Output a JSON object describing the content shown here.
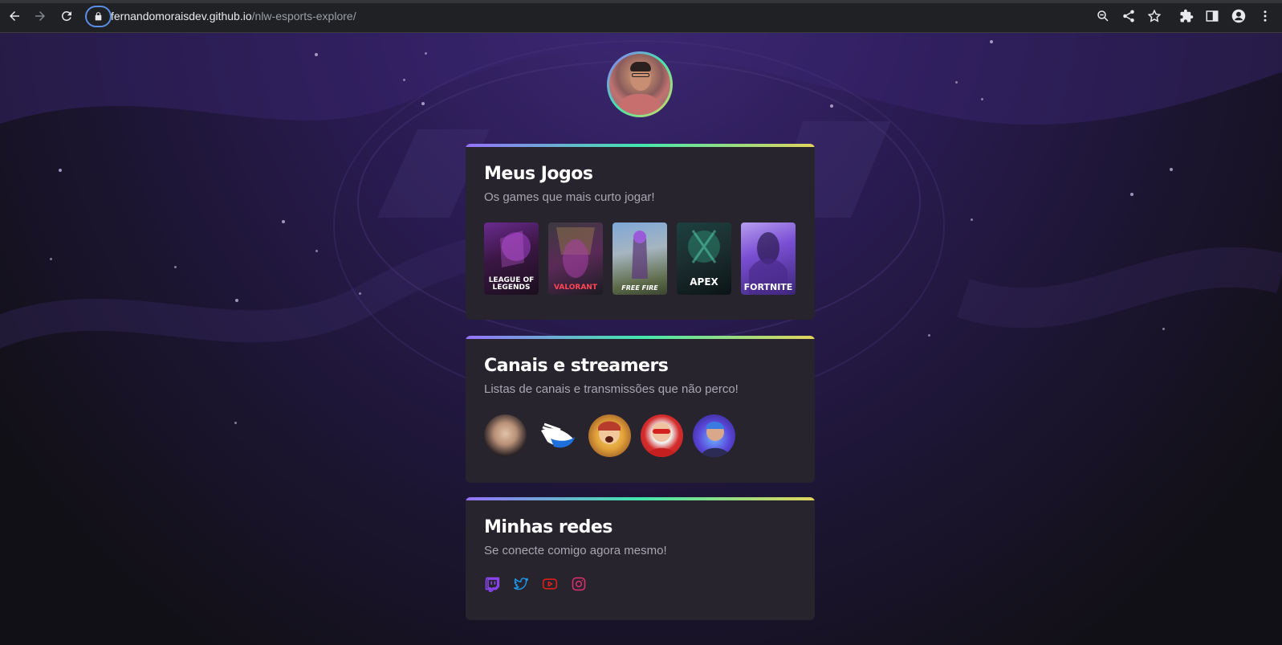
{
  "browser": {
    "url_host": "fernandomoraisdev.github.io",
    "url_path": "/nlw-esports-explore/",
    "icons": {
      "back": "arrow-left-icon",
      "forward": "arrow-right-icon",
      "reload": "reload-icon",
      "lock": "lock-icon",
      "zoom": "zoom-icon",
      "share": "share-icon",
      "bookmark": "star-icon",
      "extensions": "puzzle-icon",
      "side_panel": "side-panel-icon",
      "profile": "profile-icon",
      "menu": "kebab-menu-icon"
    }
  },
  "profile": {
    "avatar": "profile-photo"
  },
  "games_card": {
    "title": "Meus Jogos",
    "subtitle": "Os games que mais curto jogar!",
    "games": [
      {
        "label": "LEAGUE OF LEGENDS",
        "icon": "league-of-legends-cover"
      },
      {
        "label": "VALORANT",
        "icon": "valorant-cover"
      },
      {
        "label": "FREE FIRE",
        "icon": "free-fire-cover"
      },
      {
        "label": "APEX",
        "icon": "apex-legends-cover"
      },
      {
        "label": "FORTNITE",
        "icon": "fortnite-cover"
      }
    ]
  },
  "streamers_card": {
    "title": "Canais e streamers",
    "subtitle": "Listas de canais e transmissões que não perco!",
    "channels": [
      {
        "icon": "streamer-avatar-1"
      },
      {
        "icon": "streamer-avatar-2"
      },
      {
        "icon": "streamer-avatar-3"
      },
      {
        "icon": "streamer-avatar-4"
      },
      {
        "icon": "streamer-avatar-5"
      }
    ]
  },
  "social_card": {
    "title": "Minhas redes",
    "subtitle": "Se conecte comigo agora mesmo!",
    "links": [
      {
        "icon": "twitch-icon",
        "color": "#9146ff"
      },
      {
        "icon": "twitter-icon",
        "color": "#1d9bf0"
      },
      {
        "icon": "youtube-icon",
        "color": "#e62117"
      },
      {
        "icon": "instagram-icon",
        "color": "#e1306c"
      }
    ]
  },
  "colors": {
    "accent_gradient": [
      "#9572fc",
      "#43e7ad",
      "#e2d45c"
    ],
    "card_background": "#27242e"
  }
}
